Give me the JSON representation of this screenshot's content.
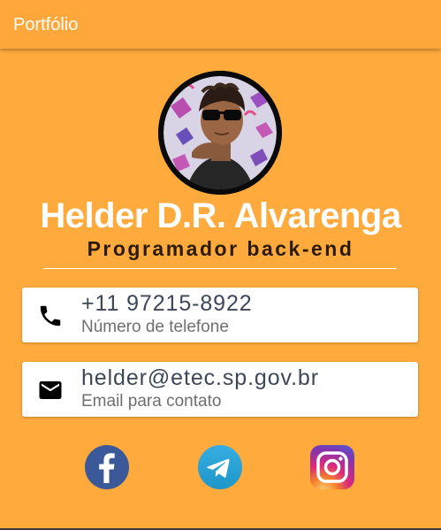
{
  "appbar": {
    "title": "Portfólio"
  },
  "profile": {
    "name": "Helder D.R. Alvarenga",
    "role": "Programador back-end",
    "avatar_icon": "profile-photo"
  },
  "contacts": {
    "phone": {
      "value": "+11 97215-8922",
      "label": "Número de telefone",
      "icon": "phone-icon"
    },
    "email": {
      "value": "helder@etec.sp.gov.br",
      "label": "Email para contato",
      "icon": "mail-icon"
    }
  },
  "social": [
    {
      "name": "facebook-icon",
      "color": "#3B5998"
    },
    {
      "name": "telegram-icon",
      "color": "#2CA5E0"
    },
    {
      "name": "instagram-icon",
      "color": "#C13584"
    }
  ],
  "colors": {
    "background": "#FFAA3D",
    "appbar": "#FFA73A",
    "card": "#FFFFFF",
    "primary_text": "#3D4757"
  }
}
